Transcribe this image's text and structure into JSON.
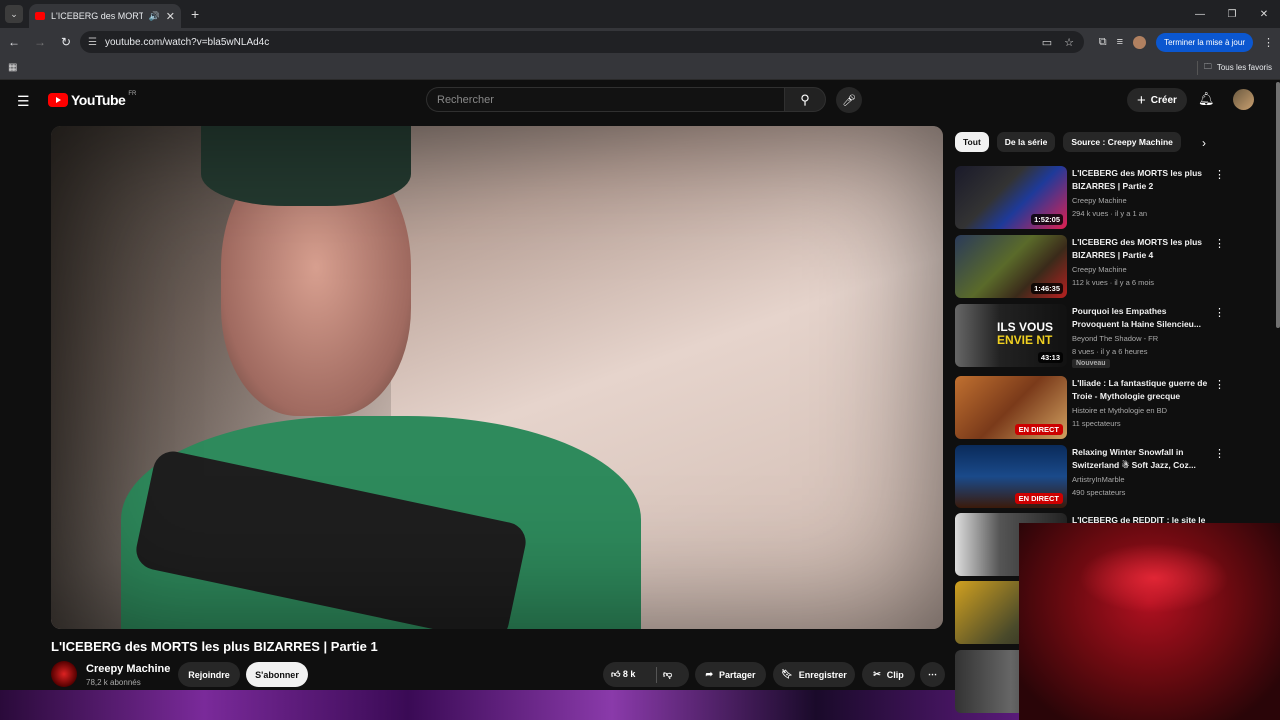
{
  "browser": {
    "tab_title": "L'ICEBERG des MORTS les p",
    "new_tab": "+",
    "url": "youtube.com/watch?v=bla5wNLAd4c",
    "update_button": "Terminer la mise à jour",
    "bookmarks_all": "Tous les favoris"
  },
  "youtube": {
    "logo_text": "YouTube",
    "logo_region": "FR",
    "search_placeholder": "Rechercher",
    "create_label": "Créer"
  },
  "video": {
    "title": "L'ICEBERG des MORTS les plus BIZARRES | Partie 1",
    "channel": "Creepy Machine",
    "subscribers": "78,2 k abonnés",
    "join_label": "Rejoindre",
    "subscribe_label": "S'abonner",
    "likes": "8 k",
    "share_label": "Partager",
    "save_label": "Enregistrer",
    "clip_label": "Clip"
  },
  "chips": [
    "Tout",
    "De la série",
    "Source : Creepy Machine"
  ],
  "recommendations": [
    {
      "title": "L'ICEBERG des MORTS les plus BIZARRES | Partie 2",
      "channel": "Creepy Machine",
      "meta": "294 k vues · il y a 1 an",
      "duration": "1:52:05"
    },
    {
      "title": "L'ICEBERG des MORTS les plus BIZARRES | Partie 4",
      "channel": "Creepy Machine",
      "meta": "112 k vues · il y a 6 mois",
      "duration": "1:46:35"
    },
    {
      "title": "Pourquoi les Empathes Provoquent la Haine Silencieu...",
      "channel": "Beyond The Shadow - FR",
      "meta": "8 vues · il y a 6 heures",
      "duration": "43:13",
      "badge": "Nouveau",
      "thumb_text_1": "ILS VOUS",
      "thumb_text_2": "ENVIE NT"
    },
    {
      "title": "L'Iliade : La fantastique guerre de Troie - Mythologie grecque",
      "channel": "Histoire et Mythologie en BD",
      "meta": "11 spectateurs",
      "live": "EN DIRECT"
    },
    {
      "title": "Relaxing Winter Snowfall in Switzerland ☃ Soft Jazz, Coz...",
      "channel": "ArtistryInMarble",
      "meta": "490 spectateurs",
      "live": "EN DIRECT"
    },
    {
      "title": "L'ICEBERG de REDDIT : le site le",
      "channel": "",
      "meta": ""
    }
  ]
}
